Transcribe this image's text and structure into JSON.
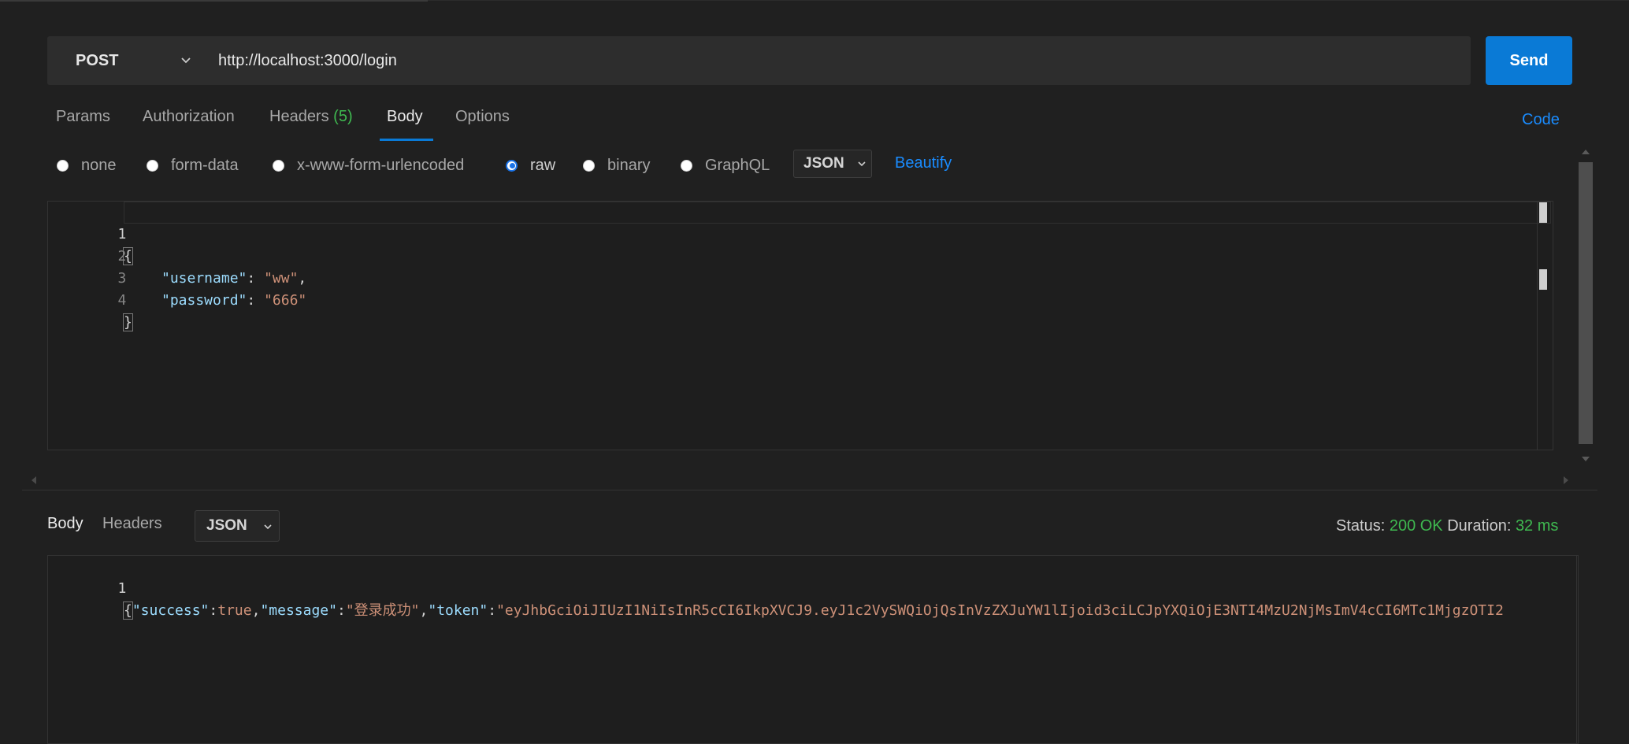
{
  "request": {
    "method": "POST",
    "url": "http://localhost:3000/login",
    "send_label": "Send"
  },
  "tabs": {
    "params": "Params",
    "authorization": "Authorization",
    "headers": "Headers",
    "headers_count": "(5)",
    "body": "Body",
    "options": "Options",
    "code": "Code"
  },
  "body_types": {
    "none": "none",
    "form_data": "form-data",
    "urlencoded": "x-www-form-urlencoded",
    "raw": "raw",
    "binary": "binary",
    "graphql": "GraphQL",
    "selected": "raw",
    "format": "JSON",
    "beautify": "Beautify"
  },
  "editor": {
    "lines": [
      {
        "n": "1",
        "text": "{"
      },
      {
        "n": "2",
        "key": "\"username\"",
        "sep": ": ",
        "val": "\"ww\"",
        "end": ","
      },
      {
        "n": "3",
        "key": "\"password\"",
        "sep": ": ",
        "val": "\"666\"",
        "end": ""
      },
      {
        "n": "4",
        "text": "}"
      }
    ]
  },
  "response": {
    "tab_body": "Body",
    "tab_headers": "Headers",
    "format": "JSON",
    "status_label": "Status:",
    "status_value": "200 OK",
    "duration_label": "Duration:",
    "duration_value": "32 ms",
    "line_number": "1",
    "p_open": "{",
    "k_success": "\"success\"",
    "colon": ":",
    "v_success": "true",
    "comma": ",",
    "k_message": "\"message\"",
    "v_message": "\"登录成功\"",
    "k_token": "\"token\"",
    "v_token": "\"eyJhbGciOiJIUzI1NiIsInR5cCI6IkpXVCJ9.eyJ1c2VySWQiOjQsInVzZXJuYW1lIjoid3ciLCJpYXQiOjE3NTI4MzU2NjMsImV4cCI6MTc1MjgzOTI2"
  }
}
